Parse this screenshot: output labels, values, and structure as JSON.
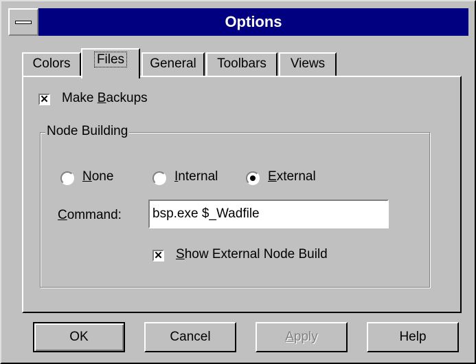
{
  "window": {
    "title": "Options"
  },
  "tabs": [
    {
      "label": "Colors",
      "active": false
    },
    {
      "label": "Files",
      "active": true
    },
    {
      "label": "General",
      "active": false
    },
    {
      "label": "Toolbars",
      "active": false
    },
    {
      "label": "Views",
      "active": false
    }
  ],
  "files": {
    "make_backups": {
      "label_pre": "Make ",
      "label_acc": "B",
      "label_post": "ackups",
      "checked": true
    },
    "node_building": {
      "group_label": "Node Building",
      "radios": [
        {
          "acc": "N",
          "rest": "one",
          "selected": false
        },
        {
          "acc": "I",
          "rest": "nternal",
          "selected": false
        },
        {
          "acc": "E",
          "rest": "xternal",
          "selected": true
        }
      ],
      "command": {
        "label_acc": "C",
        "label_rest": "ommand:",
        "value": "bsp.exe $_Wadfile"
      },
      "show_external": {
        "acc": "S",
        "rest": "how External Node Build",
        "checked": true
      }
    }
  },
  "buttons": {
    "ok": "OK",
    "cancel": "Cancel",
    "apply_acc": "A",
    "apply_rest": "pply",
    "help": "Help"
  },
  "colors": {
    "titlebar": "#000080",
    "face": "#c0c0c0"
  }
}
